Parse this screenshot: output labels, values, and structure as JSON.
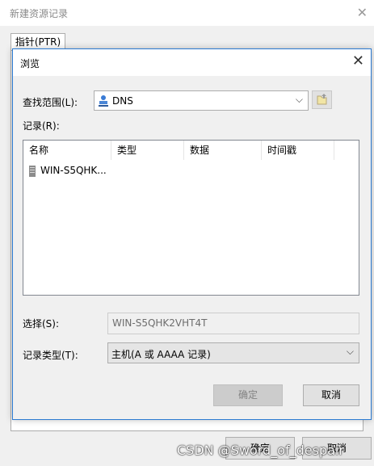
{
  "outer": {
    "title": "新建资源记录",
    "close": "✕",
    "tab": "指针(PTR)",
    "ok_label": "确定",
    "cancel_label": "取消"
  },
  "dialog": {
    "title": "浏览",
    "close": "✕",
    "scope_label": "查找范围(L):",
    "scope_value": "DNS",
    "records_label": "记录(R):",
    "columns": [
      "名称",
      "类型",
      "数据",
      "时间戳"
    ],
    "rows": [
      {
        "name": "WIN-S5QHK..."
      }
    ],
    "selection_label": "选择(S):",
    "selection_value": "WIN-S5QHK2VHT4T",
    "record_type_label": "记录类型(T):",
    "record_type_value": "主机(A 或 AAAA 记录)",
    "ok_label": "确定",
    "cancel_label": "取消"
  },
  "watermark": "CSDN @Sword_of_despair",
  "colors": {
    "dialog_border": "#2b7ad1"
  }
}
